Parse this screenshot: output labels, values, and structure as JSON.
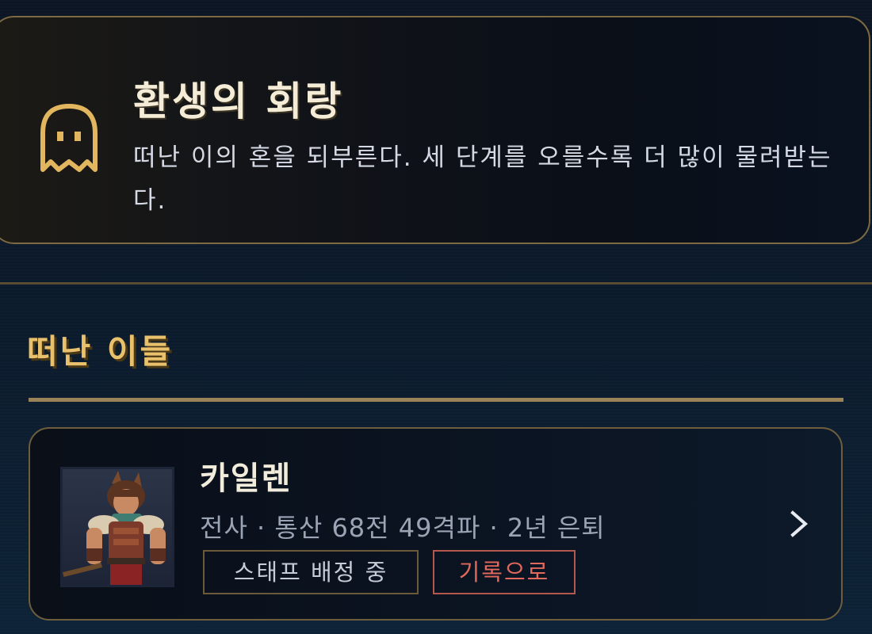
{
  "banner": {
    "icon": "ghost-icon",
    "title": "환생의 회랑",
    "description": "떠난 이의 혼을 되부른다. 세 단계를 오를수록 더 많이 물려받는다."
  },
  "section": {
    "title": "떠난 이들"
  },
  "departed": [
    {
      "name": "카일렌",
      "meta": "전사 · 통산 68전 49격파 · 2년 은퇴",
      "tags": {
        "staff": "스태프 배정 중",
        "record": "기록으로"
      },
      "portrait": "warrior-portrait"
    }
  ],
  "colors": {
    "accent_gold": "#e9c16c",
    "border_gold": "#7d6a42",
    "record_red": "#e0695c",
    "background": "#0b1a2b"
  }
}
